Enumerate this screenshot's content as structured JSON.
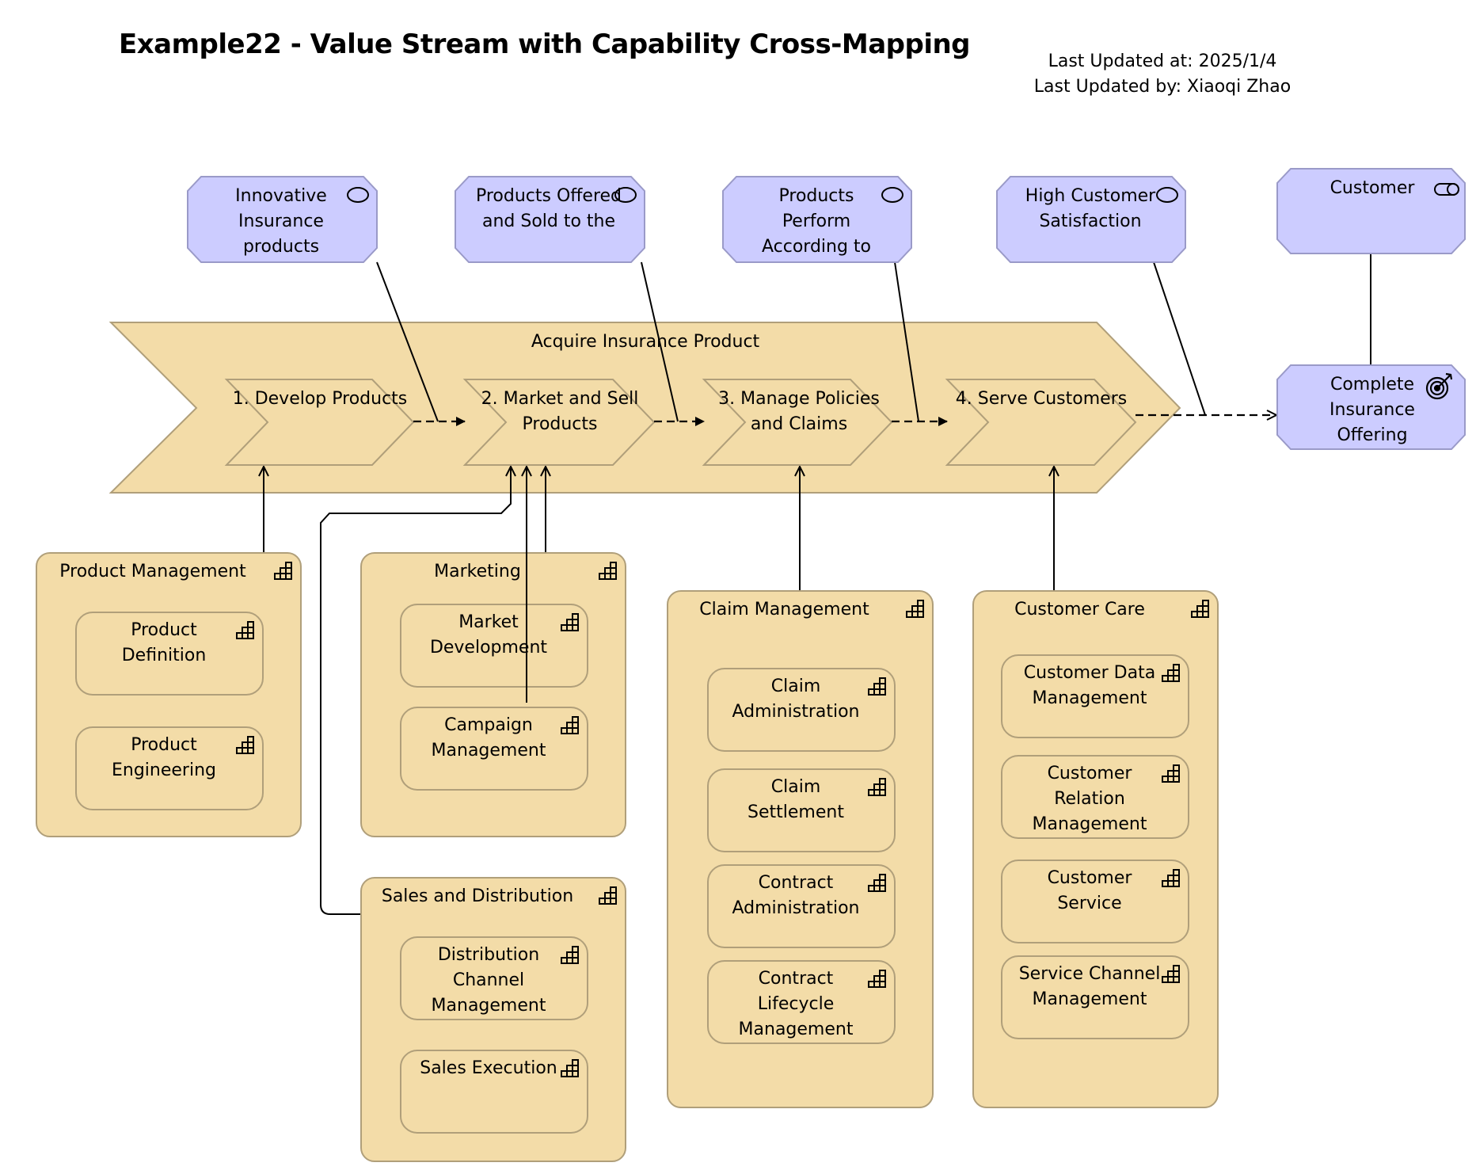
{
  "header": {
    "title": "Example22 - Value Stream with Capability Cross-Mapping",
    "last_updated_at": "Last Updated at: 2025/1/4",
    "last_updated_by": "Last Updated by: Xiaoqi Zhao"
  },
  "colors": {
    "motivation_fill": "#ccccff",
    "motivation_border": "#9a9ac8",
    "strategy_fill": "#f3dca8",
    "strategy_border": "#b09f7a",
    "line": "#000000"
  },
  "outcomes": [
    {
      "label": "Innovative Insurance products",
      "icon": "outcome-icon"
    },
    {
      "label": "Products Offered and Sold to the",
      "icon": "outcome-icon"
    },
    {
      "label": "Products Perform According to",
      "icon": "outcome-icon"
    },
    {
      "label": "High Customer Satisfaction",
      "icon": "outcome-icon"
    }
  ],
  "stakeholder": {
    "label": "Customer",
    "icon": "stakeholder-icon"
  },
  "value": {
    "label": "Complete Insurance Offering",
    "icon": "target-icon"
  },
  "value_stream": {
    "label": "Acquire Insurance Product",
    "stages": [
      {
        "label": "1. Develop Products"
      },
      {
        "label": "2. Market and Sell Products"
      },
      {
        "label": "3. Manage Policies and Claims"
      },
      {
        "label": "4. Serve Customers"
      }
    ]
  },
  "capabilities": [
    {
      "label": "Product Management",
      "children": [
        "Product Definition",
        "Product Engineering"
      ]
    },
    {
      "label": "Marketing",
      "children": [
        "Market Development",
        "Campaign Management"
      ]
    },
    {
      "label": "Sales and Distribution",
      "children": [
        "Distribution Channel Management",
        "Sales Execution"
      ]
    },
    {
      "label": "Claim Management",
      "children": [
        "Claim Administration",
        "Claim Settlement",
        "Contract Administration",
        "Contract Lifecycle Management"
      ]
    },
    {
      "label": "Customer Care",
      "children": [
        "Customer Data Management",
        "Customer Relation Management",
        "Customer Service",
        "Service Channel Management"
      ]
    }
  ]
}
